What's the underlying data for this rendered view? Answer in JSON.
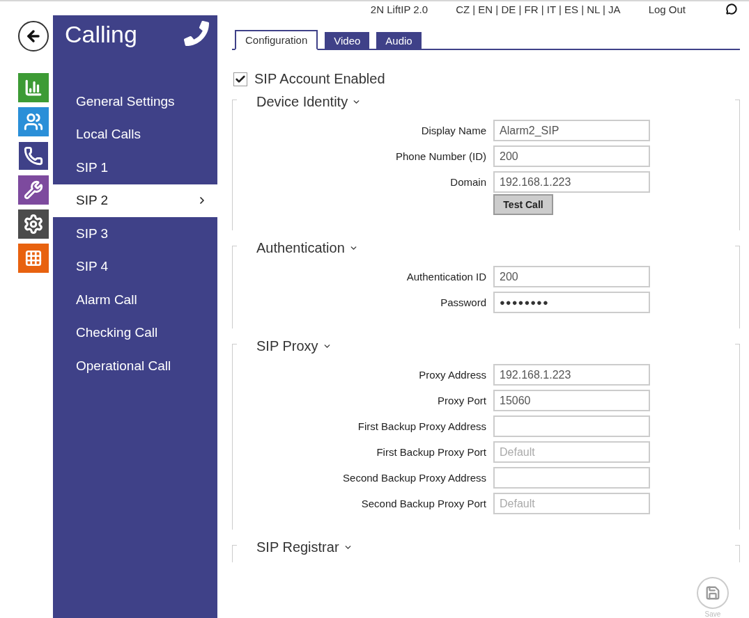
{
  "top_bar": {
    "product": "2N LiftIP 2.0",
    "languages": "CZ | EN | DE | FR | IT | ES | NL | JA",
    "logout": "Log Out"
  },
  "nav_icons": [
    {
      "kind": "back",
      "color": "#ffffff",
      "selected": false
    },
    {
      "kind": "chart",
      "color": "#3d9b35",
      "selected": false
    },
    {
      "kind": "users",
      "color": "#2a8fd8",
      "selected": false
    },
    {
      "kind": "phone",
      "color": "#3f4188",
      "selected": true
    },
    {
      "kind": "tools",
      "color": "#7d4a9e",
      "selected": false
    },
    {
      "kind": "gear",
      "color": "#4b4b4b",
      "selected": false
    },
    {
      "kind": "grid",
      "color": "#e8620f",
      "selected": false
    }
  ],
  "sidebar": {
    "title": "Calling",
    "items": [
      {
        "label": "General Settings",
        "selected": false
      },
      {
        "label": "Local Calls",
        "selected": false
      },
      {
        "label": "SIP 1",
        "selected": false
      },
      {
        "label": "SIP 2",
        "selected": true
      },
      {
        "label": "SIP 3",
        "selected": false
      },
      {
        "label": "SIP 4",
        "selected": false
      },
      {
        "label": "Alarm Call",
        "selected": false
      },
      {
        "label": "Checking Call",
        "selected": false
      },
      {
        "label": "Operational Call",
        "selected": false
      }
    ]
  },
  "tabs": [
    {
      "label": "Configuration",
      "selected": true
    },
    {
      "label": "Video",
      "selected": false
    },
    {
      "label": "Audio",
      "selected": false
    }
  ],
  "account_enabled": {
    "label": "SIP Account Enabled",
    "checked": true
  },
  "sections": [
    {
      "title": "Device Identity",
      "rows": [
        {
          "kind": "field",
          "label": "Display Name",
          "value": "Alarm2_SIP"
        },
        {
          "kind": "field",
          "label": "Phone Number (ID)",
          "value": "200"
        },
        {
          "kind": "field",
          "label": "Domain",
          "value": "192.168.1.223"
        },
        {
          "kind": "button",
          "label": "Test Call"
        }
      ]
    },
    {
      "title": "Authentication",
      "rows": [
        {
          "kind": "field",
          "label": "Authentication ID",
          "value": "200"
        },
        {
          "kind": "password",
          "label": "Password",
          "value": "●●●●●●●●"
        }
      ]
    },
    {
      "title": "SIP Proxy",
      "rows": [
        {
          "kind": "field",
          "label": "Proxy Address",
          "value": "192.168.1.223"
        },
        {
          "kind": "field",
          "label": "Proxy Port",
          "value": "15060"
        },
        {
          "kind": "field",
          "label": "First Backup Proxy Address"
        },
        {
          "kind": "field",
          "label": "First Backup Proxy Port",
          "placeholder": "Default"
        },
        {
          "kind": "field",
          "label": "Second Backup Proxy Address"
        },
        {
          "kind": "field",
          "label": "Second Backup Proxy Port",
          "placeholder": "Default"
        }
      ]
    },
    {
      "title": "SIP Registrar"
    }
  ],
  "save": {
    "label": "Save",
    "disabled": true
  }
}
